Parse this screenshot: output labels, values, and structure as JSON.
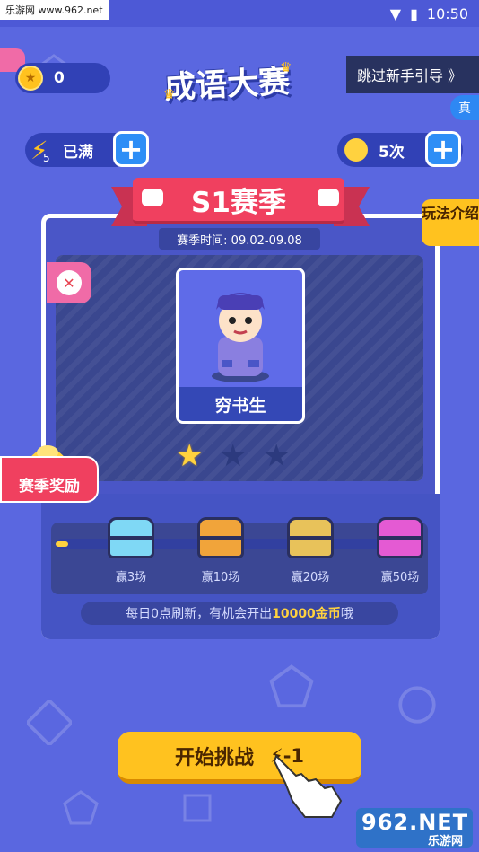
{
  "status_bar": {
    "site": "乐游网 www.962.net",
    "time": "10:50",
    "icons": [
      "wifi-icon",
      "battery-icon"
    ]
  },
  "header": {
    "coins": "0",
    "game_title": "成语大赛",
    "skip_tutorial": "跳过新手引导 》",
    "side_tab": "真"
  },
  "resources": {
    "energy_count": "5",
    "energy_status": "已满",
    "hint_count": "5次"
  },
  "season": {
    "title": "S1赛季",
    "time": "赛季时间: 09.02-09.08",
    "how_to_play": "玩法介绍"
  },
  "character": {
    "name": "穷书生",
    "stars_earned": 1,
    "stars_total": 3
  },
  "season_reward": "赛季奖励",
  "milestones": [
    {
      "label": "赢3场",
      "color": "#7fd8f5"
    },
    {
      "label": "赢10场",
      "color": "#f1a43a"
    },
    {
      "label": "赢20场",
      "color": "#e8c25a"
    },
    {
      "label": "赢50场",
      "color": "#e45ad3"
    }
  ],
  "progress_fraction": 0.03,
  "refresh_note": {
    "prefix": "每日0点刷新，有机会开出",
    "highlight": "10000金币",
    "suffix": "哦"
  },
  "start": {
    "label": "开始挑战",
    "cost": "-1"
  },
  "watermark": {
    "main": "962.NET",
    "sub": "乐游网"
  },
  "colors": {
    "background": "#5a67e0",
    "accent_gold": "#ffc21f",
    "ribbon_red": "#f0405f",
    "plus_blue": "#2e8ef6"
  }
}
